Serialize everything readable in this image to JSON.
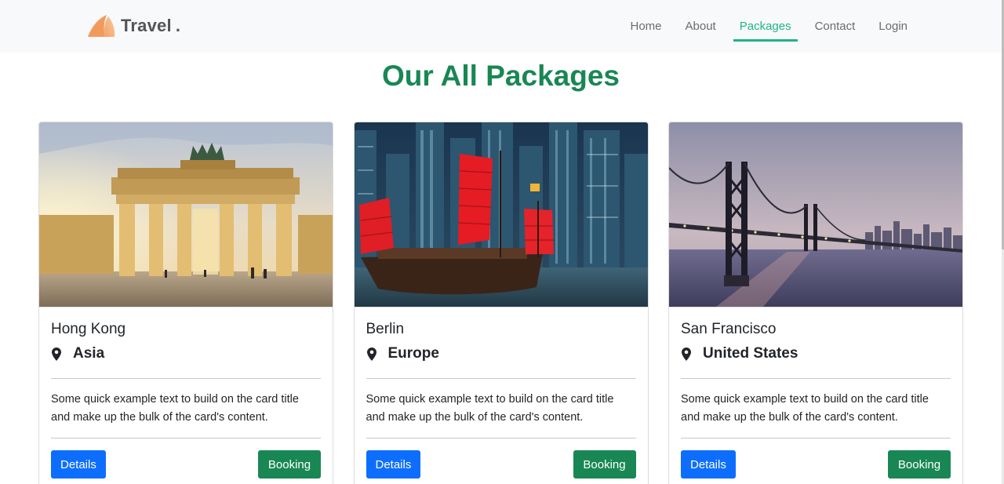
{
  "brand": {
    "name": "Travel",
    "dot": ".",
    "logo_icon": "orange-sail-icon"
  },
  "nav": {
    "items": [
      {
        "label": "Home",
        "active": false
      },
      {
        "label": "About",
        "active": false
      },
      {
        "label": "Packages",
        "active": true
      },
      {
        "label": "Contact",
        "active": false
      },
      {
        "label": "Login",
        "active": false
      }
    ],
    "active_color": "#20b486"
  },
  "page": {
    "title": "Our All Packages",
    "title_color": "#198754"
  },
  "cards": [
    {
      "title": "Hong Kong",
      "location": "Asia",
      "location_icon": "map-pin-icon",
      "text": "Some quick example text to build on the card title and make up the bulk of the card's content.",
      "details_label": "Details",
      "booking_label": "Booking"
    },
    {
      "title": "Berlin",
      "location": "Europe",
      "location_icon": "map-pin-icon",
      "text": "Some quick example text to build on the card title and make up the bulk of the card's content.",
      "details_label": "Details",
      "booking_label": "Booking"
    },
    {
      "title": "San Francisco",
      "location": "United States",
      "location_icon": "map-pin-icon",
      "text": "Some quick example text to build on the card title and make up the bulk of the card's content.",
      "details_label": "Details",
      "booking_label": "Booking"
    }
  ],
  "colors": {
    "details_button": "#0d6efd",
    "booking_button": "#198754",
    "navbar_bg": "#f8f9fa"
  }
}
